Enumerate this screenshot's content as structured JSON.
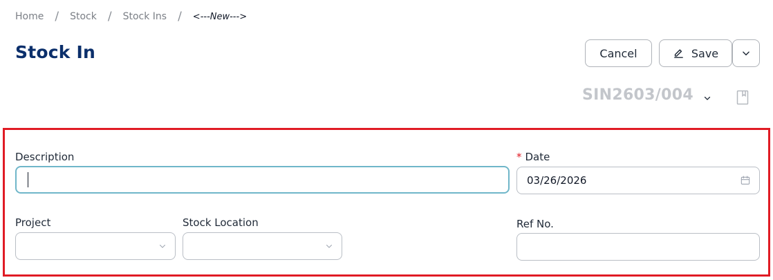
{
  "breadcrumb": {
    "items": [
      "Home",
      "Stock",
      "Stock Ins",
      "<---New--->"
    ],
    "separator": "/"
  },
  "page": {
    "title": "Stock In"
  },
  "toolbar": {
    "cancel_label": "Cancel",
    "save_label": "Save",
    "save_icon": "pencil-icon",
    "more_icon": "chevron-down-icon"
  },
  "document": {
    "number": "SIN2603/004",
    "number_icon": "chevron-down-icon",
    "bookmark_icon": "bookmark-icon"
  },
  "form": {
    "description": {
      "label": "Description",
      "value": ""
    },
    "date": {
      "label": "Date",
      "required_mark": "*",
      "value": "03/26/2026",
      "icon": "calendar-icon"
    },
    "project": {
      "label": "Project",
      "value": "",
      "icon": "chevron-down-icon"
    },
    "stock_location": {
      "label": "Stock Location",
      "value": "",
      "icon": "chevron-down-icon"
    },
    "ref_no": {
      "label": "Ref No.",
      "value": ""
    }
  },
  "colors": {
    "title": "#0b2f6b",
    "highlight_border": "#e01b24",
    "focus_border": "#6fb6c9",
    "required": "#e01b24",
    "muted_docno": "#c3c6cb"
  }
}
